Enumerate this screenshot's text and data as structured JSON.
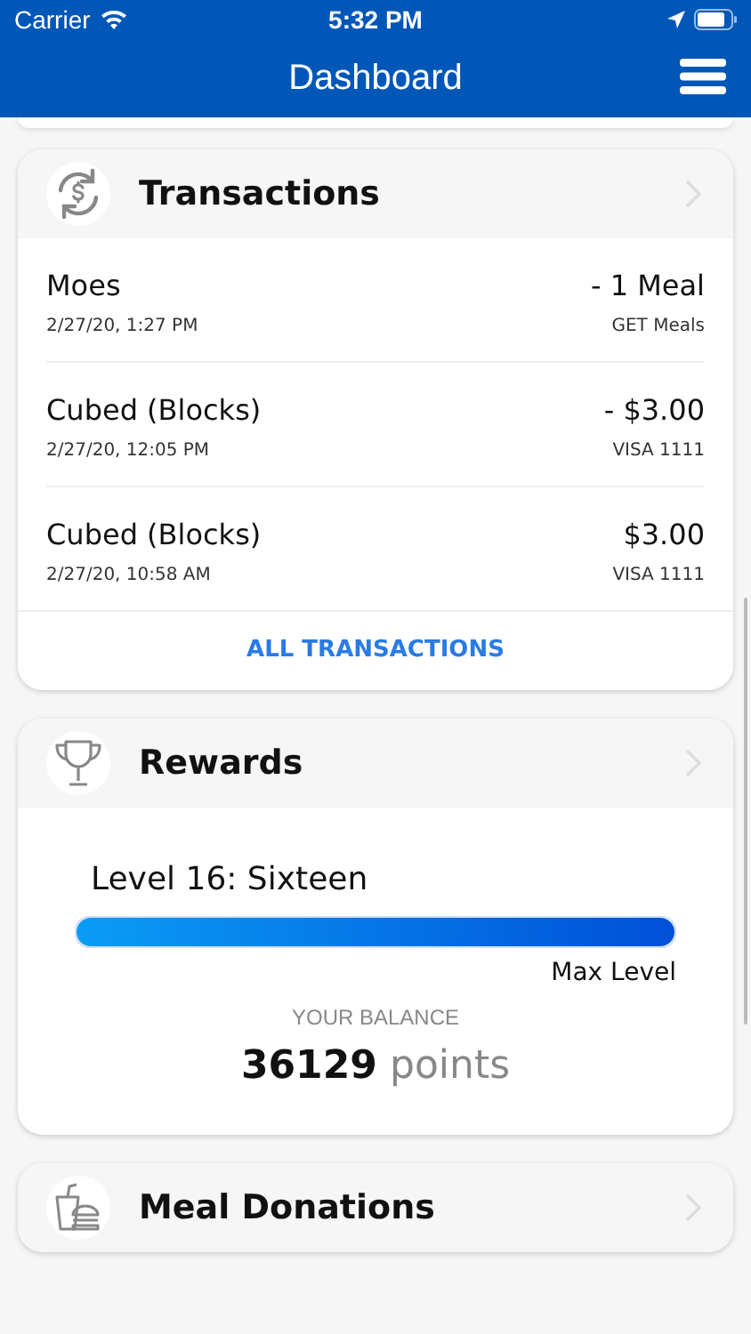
{
  "status_bar": {
    "carrier": "Carrier",
    "time": "5:32 PM"
  },
  "nav": {
    "title": "Dashboard"
  },
  "transactions": {
    "title": "Transactions",
    "rows": [
      {
        "name": "Moes",
        "date": "2/27/20, 1:27 PM",
        "amount": "- 1 Meal",
        "method": "GET Meals"
      },
      {
        "name": "Cubed (Blocks)",
        "date": "2/27/20, 12:05 PM",
        "amount": "- $3.00",
        "method": "VISA 1111"
      },
      {
        "name": "Cubed (Blocks)",
        "date": "2/27/20, 10:58 AM",
        "amount": "$3.00",
        "method": "VISA 1111"
      }
    ],
    "link": "ALL TRANSACTIONS"
  },
  "rewards": {
    "title": "Rewards",
    "level_name": "Level 16: Sixteen",
    "level": 1.0,
    "level_caption": "Max Level",
    "balance_label": "YOUR BALANCE",
    "balance": "**36129** points"
  },
  "donations": {
    "title": "Meal Donations"
  }
}
